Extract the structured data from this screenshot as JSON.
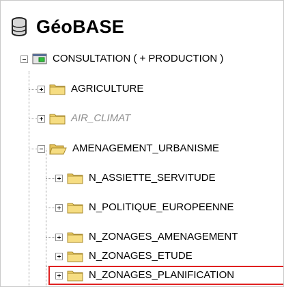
{
  "root": {
    "title": "GéoBASE",
    "icon": "database-icon"
  },
  "tree": [
    {
      "label": "CONSULTATION  ( + PRODUCTION )",
      "icon": "app-window-icon",
      "expanded": true
    },
    {
      "label": "AGRICULTURE",
      "icon": "folder-icon",
      "expanded": false
    },
    {
      "label": "AIR_CLIMAT",
      "icon": "folder-icon",
      "expanded": false,
      "disabled": true
    },
    {
      "label": "AMENAGEMENT_URBANISME",
      "icon": "folder-open-icon",
      "expanded": true
    },
    {
      "label": "N_ASSIETTE_SERVITUDE",
      "icon": "folder-icon",
      "expanded": false
    },
    {
      "label": "N_POLITIQUE_EUROPEENNE",
      "icon": "folder-icon",
      "expanded": false
    },
    {
      "label": "N_ZONAGES_AMENAGEMENT",
      "icon": "folder-icon",
      "expanded": false
    },
    {
      "label": "N_ZONAGES_ETUDE",
      "icon": "folder-icon",
      "expanded": false
    },
    {
      "label": "N_ZONAGES_PLANIFICATION",
      "icon": "folder-icon",
      "expanded": false,
      "highlighted": true
    }
  ],
  "colors": {
    "folder": "#f2d369",
    "highlight": "#e02020",
    "disabled_text": "#8f8f8f"
  }
}
